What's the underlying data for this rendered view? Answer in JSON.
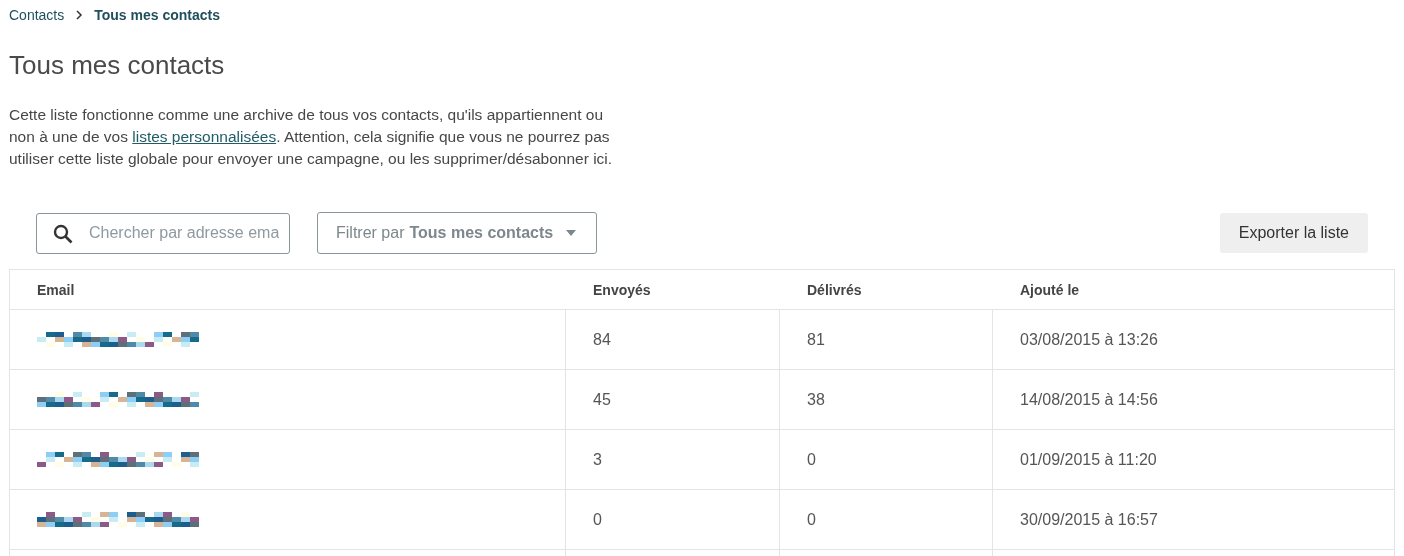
{
  "breadcrumb": [
    {
      "label": "Contacts",
      "current": false
    },
    {
      "label": "Tous mes contacts",
      "current": true
    }
  ],
  "title": "Tous mes contacts",
  "description": {
    "before": "Cette liste fonctionne comme une archive de tous vos contacts, qu'ils appartiennent ou non à une de vos ",
    "link": "listes personnalisées",
    "after": ". Attention, cela signifie que vous ne pourrez pas utiliser cette liste globale pour envoyer une campagne, ou les supprimer/désabonner ici."
  },
  "search": {
    "placeholder": "Chercher par adresse ema"
  },
  "filter": {
    "label": "Filtrer par",
    "value": "Tous mes contacts"
  },
  "export_button": "Exporter la liste",
  "table": {
    "columns": [
      "Email",
      "Envoyés",
      "Délivrés",
      "Ajouté le"
    ],
    "rows": [
      {
        "sent": "84",
        "delivered": "81",
        "added": "03/08/2015 à 13:26"
      },
      {
        "sent": "45",
        "delivered": "38",
        "added": "14/08/2015 à 14:56"
      },
      {
        "sent": "3",
        "delivered": "0",
        "added": "01/09/2015 à 11:20"
      },
      {
        "sent": "0",
        "delivered": "0",
        "added": "30/09/2015 à 16:57"
      }
    ]
  }
}
